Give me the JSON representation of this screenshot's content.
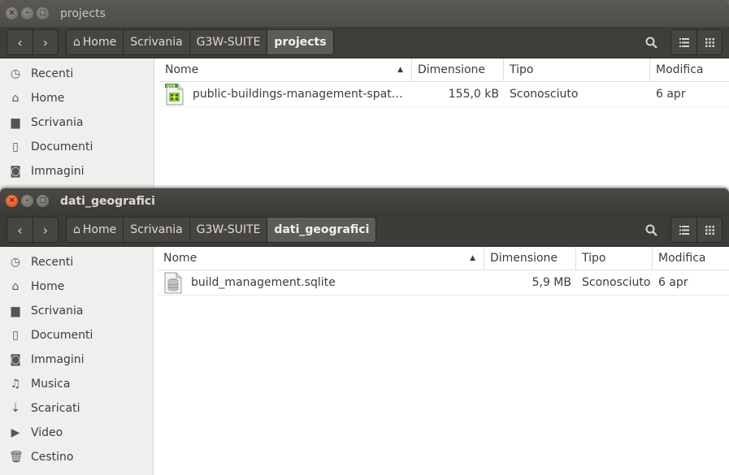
{
  "windows": [
    {
      "title": "projects",
      "breadcrumbs": [
        "Home",
        "Scrivania",
        "G3W-SUITE",
        "projects"
      ],
      "sidebar": [
        {
          "label": "Recenti",
          "icon": "clock-icon"
        },
        {
          "label": "Home",
          "icon": "home-icon"
        },
        {
          "label": "Scrivania",
          "icon": "folder-icon"
        },
        {
          "label": "Documenti",
          "icon": "document-icon"
        },
        {
          "label": "Immagini",
          "icon": "camera-icon"
        }
      ],
      "columns": [
        "Nome",
        "Dimensione",
        "Tipo",
        "Modifica"
      ],
      "files": [
        {
          "name": "public-buildings-management-spat…",
          "size": "155,0 kB",
          "type": "Sconosciuto",
          "modified": "6 apr",
          "icon": "qgs-file-icon"
        }
      ]
    },
    {
      "title": "dati_geografici",
      "breadcrumbs": [
        "Home",
        "Scrivania",
        "G3W-SUITE",
        "dati_geografici"
      ],
      "sidebar": [
        {
          "label": "Recenti",
          "icon": "clock-icon"
        },
        {
          "label": "Home",
          "icon": "home-icon"
        },
        {
          "label": "Scrivania",
          "icon": "folder-icon"
        },
        {
          "label": "Documenti",
          "icon": "document-icon"
        },
        {
          "label": "Immagini",
          "icon": "camera-icon"
        },
        {
          "label": "Musica",
          "icon": "music-icon"
        },
        {
          "label": "Scaricati",
          "icon": "download-icon"
        },
        {
          "label": "Video",
          "icon": "video-icon"
        },
        {
          "label": "Cestino",
          "icon": "trash-icon"
        }
      ],
      "columns": [
        "Nome",
        "Dimensione",
        "Tipo",
        "Modifica"
      ],
      "files": [
        {
          "name": "build_management.sqlite",
          "size": "5,9 MB",
          "type": "Sconosciuto",
          "modified": "6 apr",
          "icon": "database-file-icon"
        }
      ]
    }
  ]
}
